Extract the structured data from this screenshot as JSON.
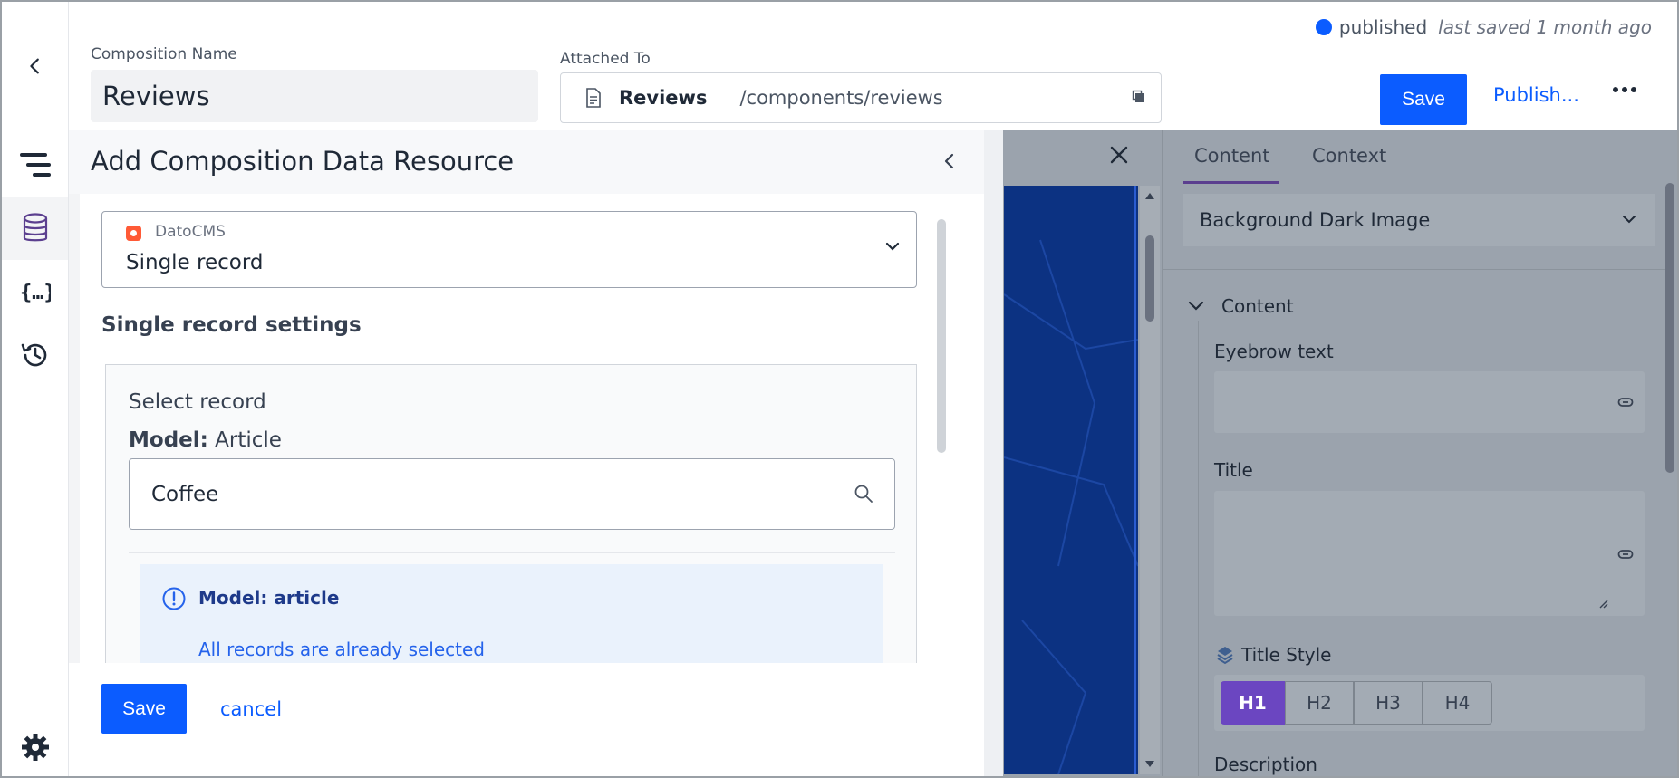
{
  "header": {
    "composition_name_label": "Composition Name",
    "composition_name_value": "Reviews",
    "attached_to_label": "Attached To",
    "attached_name": "Reviews",
    "attached_path": "/components/reviews",
    "status": "published",
    "last_saved": "last saved 1 month ago",
    "save_label": "Save",
    "publish_label": "Publish..."
  },
  "preview": {
    "tabs": [
      "Content",
      "Context"
    ],
    "active_tab": "Content",
    "background_select": "Background Dark Image",
    "section": "Content",
    "eyebrow_label": "Eyebrow text",
    "title_label": "Title",
    "title_style_label": "Title Style",
    "title_styles": [
      "H1",
      "H2",
      "H3",
      "H4"
    ],
    "selected_title_style": "H1",
    "description_label": "Description"
  },
  "modal": {
    "title": "Add Composition Data Resource",
    "source_name": "DatoCMS",
    "source_type": "Single record",
    "section_title": "Single record settings",
    "select_record_label": "Select record",
    "model_prefix": "Model:",
    "model_value": "Article",
    "search_value": "Coffee",
    "info_title": "Model: article",
    "info_body": "All records are already selected",
    "save_label": "Save",
    "cancel_label": "cancel"
  },
  "colors": {
    "primary": "#0b5cff",
    "status_published": "#0b5cff",
    "active_style": "#6b46c1",
    "info_bg": "#eaf2fc"
  }
}
